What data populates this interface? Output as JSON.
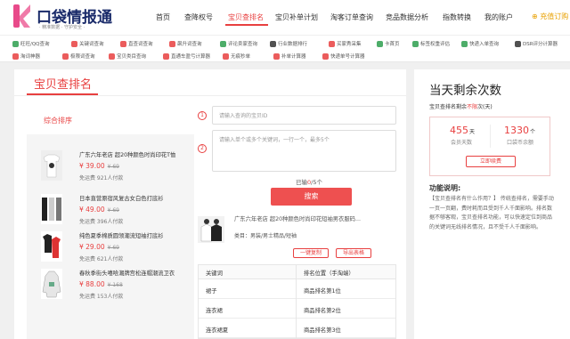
{
  "header": {
    "logo_title": "口袋情报通",
    "logo_slogan": "· 精准数据 · 守护安全 ·",
    "nav": [
      "首页",
      "查降权号",
      "宝贝查排名",
      "宝贝补单计划",
      "淘客订单查询",
      "竞品数据分析",
      "指数转换",
      "我的账户"
    ],
    "active_nav": "宝贝查排名",
    "recharge": "充值订购"
  },
  "tools": [
    {
      "label": "旺旺/QQ查询",
      "color": "#2e9f4f"
    },
    {
      "label": "关键词查询",
      "color": "#e84040"
    },
    {
      "label": "直查词查询",
      "color": "#e84040"
    },
    {
      "label": "飙升词查询",
      "color": "#e84040"
    },
    {
      "label": "评论卖家查询",
      "color": "#2e9f4f"
    },
    {
      "label": "行业数据排行",
      "color": "#333333"
    },
    {
      "label": "买家秀采集",
      "color": "#e84040"
    },
    {
      "label": "卡首页",
      "color": "#2e9f4f"
    },
    {
      "label": "标签权重评估",
      "color": "#2e9f4f"
    },
    {
      "label": "快递入单查询",
      "color": "#2e9f4f"
    },
    {
      "label": "DSR评分计算器",
      "color": "#333333"
    },
    {
      "label": "淘词神器",
      "color": "#e84040"
    },
    {
      "label": "极限词查询",
      "color": "#e84040"
    },
    {
      "label": "宝贝类目查询",
      "color": "#e84040"
    },
    {
      "label": "直通车盈亏计算器",
      "color": "#e84040"
    },
    {
      "label": "无痕秒单",
      "color": "#e84040"
    },
    {
      "label": "补单计算器",
      "color": "#e84040"
    },
    {
      "label": "快递单号计算器",
      "color": "#e84040"
    }
  ],
  "main": {
    "title": "宝贝查排名",
    "sort_label": "综合排序",
    "products": [
      {
        "name": "广东六年老店 超20种颜色时尚印花T恤",
        "price": "¥ 39.00",
        "old_price": "¥ 69",
        "sales": "免运费 921人付款"
      },
      {
        "name": "日本直营原宿风复古女白色打底衫",
        "price": "¥ 49.00",
        "old_price": "¥ 69",
        "sales": "免运费 396人付款"
      },
      {
        "name": "纯色夏季棉质圆领潮流短袖打底衫",
        "price": "¥ 29.00",
        "old_price": "¥ 69",
        "sales": "免运费 621人付款"
      },
      {
        "name": "春秋季街头嘻哈潮牌宫松连帽潮流卫衣",
        "price": "¥ 88.00",
        "old_price": "¥ 168",
        "sales": "免运费 153人付款"
      }
    ],
    "step1": "1",
    "step2": "2",
    "url_placeholder": "请输入查询的宝贝ID",
    "keyword_placeholder": "请输入单个或多个关键词，一行一个，最多5个",
    "status_prefix": "已输",
    "status_count": "0",
    "status_suffix": "/5个",
    "search_button": "搜索",
    "result": {
      "name": "广东六年老店 超20种颜色时尚印花短袖男衣服码...",
      "category": "类目：男装/男士精品/短袖"
    },
    "copy_button": "一键复制",
    "export_button": "导出表格",
    "table": {
      "headers": [
        "关键词",
        "排名位置（手淘端）"
      ],
      "rows": [
        [
          "裙子",
          "商品排名第1位"
        ],
        [
          "连衣裙",
          "商品排名第2位"
        ],
        [
          "连衣裙夏",
          "商品排名第3位"
        ]
      ]
    }
  },
  "side": {
    "title": "当天剩余次数",
    "sub_prefix": "宝贝查排名剩余",
    "sub_highlight": "不限",
    "sub_suffix": "次(天)",
    "days_value": "455",
    "days_unit": "天",
    "days_label": "会员天数",
    "count_value": "1330",
    "count_unit": "个",
    "count_label": "口袋币余额",
    "buy_button": "立即续费",
    "desc_title": "功能说明:",
    "desc_text": "【宝贝查排名有什么作用？】 传统查排名，需要手动一页一页翻，费时耗而且受到千人千面影响。排名数据不够客观，宝贝查排名功能，可以快速定位到商品的关键词无线排名情况，且不受千人千面影响。"
  }
}
